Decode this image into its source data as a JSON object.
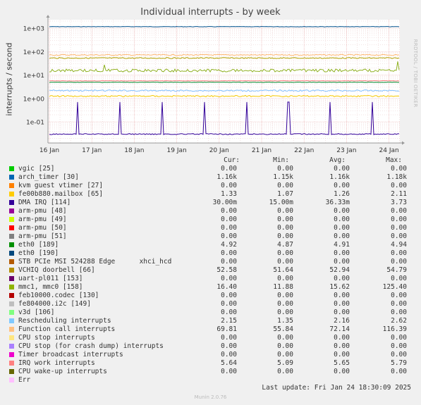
{
  "chart_data": {
    "type": "line",
    "title": "Individual interrupts - by week",
    "ylabel": "interrupts / second",
    "yscale": "log",
    "ylim": [
      0.02,
      1500
    ],
    "yticks": [
      "1e+03",
      "1e+02",
      "1e+01",
      "1e+00",
      "1e-01"
    ],
    "ytick_values": [
      1000,
      100,
      10,
      1,
      0.1
    ],
    "xticks": [
      "16 Jan",
      "17 Jan",
      "18 Jan",
      "19 Jan",
      "20 Jan",
      "21 Jan",
      "22 Jan",
      "23 Jan",
      "24 Jan"
    ],
    "grid": true,
    "series": [
      {
        "name": "arch_timer [30]",
        "color": "#00508c",
        "level": 1160
      },
      {
        "name": "Function call interrupts",
        "color": "#ffb870",
        "level": 72
      },
      {
        "name": "VCHIQ doorbell [66]",
        "color": "#b0a000",
        "level": 53
      },
      {
        "name": "mmc1, mmc0 [158]",
        "color": "#8fb021",
        "level": 15.6
      },
      {
        "name": "eth0 [189]",
        "color": "#008a2e",
        "level": 4.9
      },
      {
        "name": "IRQ work interrupts",
        "color": "#ff8080",
        "level": 5.65
      },
      {
        "name": "Rescheduling interrupts",
        "color": "#7fbfff",
        "level": 2.16
      },
      {
        "name": "fe00b880.mailbox [65]",
        "color": "#f5c800",
        "level": 1.26
      },
      {
        "name": "DMA IRQ [114]",
        "color": "#330099",
        "level": 0.03,
        "peak": 0.7
      }
    ]
  },
  "legend": {
    "headers": {
      "cur": "Cur:",
      "min": "Min:",
      "avg": "Avg:",
      "max": "Max:"
    },
    "rows": [
      {
        "label": "vgic [25]",
        "color": "#00cc00",
        "cur": "0.00",
        "min": "0.00",
        "avg": "0.00",
        "max": "0.00"
      },
      {
        "label": "arch_timer [30]",
        "color": "#0066b3",
        "cur": "1.16k",
        "min": "1.15k",
        "avg": "1.16k",
        "max": "1.18k"
      },
      {
        "label": "kvm guest vtimer [27]",
        "color": "#ff8000",
        "cur": "0.00",
        "min": "0.00",
        "avg": "0.00",
        "max": "0.00"
      },
      {
        "label": "fe00b880.mailbox [65]",
        "color": "#ffcc00",
        "cur": "1.33",
        "min": "1.07",
        "avg": "1.26",
        "max": "2.11"
      },
      {
        "label": "DMA IRQ [114]",
        "color": "#330099",
        "cur": "30.00m",
        "min": "15.00m",
        "avg": "36.33m",
        "max": "3.73"
      },
      {
        "label": "arm-pmu [48]",
        "color": "#990099",
        "cur": "0.00",
        "min": "0.00",
        "avg": "0.00",
        "max": "0.00"
      },
      {
        "label": "arm-pmu [49]",
        "color": "#ccff00",
        "cur": "0.00",
        "min": "0.00",
        "avg": "0.00",
        "max": "0.00"
      },
      {
        "label": "arm-pmu [50]",
        "color": "#ff0000",
        "cur": "0.00",
        "min": "0.00",
        "avg": "0.00",
        "max": "0.00"
      },
      {
        "label": "arm-pmu [51]",
        "color": "#808080",
        "cur": "0.00",
        "min": "0.00",
        "avg": "0.00",
        "max": "0.00"
      },
      {
        "label": "eth0 [189]",
        "color": "#008f00",
        "cur": "4.92",
        "min": "4.87",
        "avg": "4.91",
        "max": "4.94"
      },
      {
        "label": "eth0 [190]",
        "color": "#00487d",
        "cur": "0.00",
        "min": "0.00",
        "avg": "0.00",
        "max": "0.00"
      },
      {
        "label": "STB PCIe MSI 524288 Edge      xhci_hcd",
        "color": "#b35a00",
        "cur": "0.00",
        "min": "0.00",
        "avg": "0.00",
        "max": "0.00"
      },
      {
        "label": "VCHIQ doorbell [66]",
        "color": "#b38f00",
        "cur": "52.58",
        "min": "51.64",
        "avg": "52.94",
        "max": "54.79"
      },
      {
        "label": "uart-pl011 [153]",
        "color": "#6b006b",
        "cur": "0.00",
        "min": "0.00",
        "avg": "0.00",
        "max": "0.00"
      },
      {
        "label": "mmc1, mmc0 [158]",
        "color": "#8fb300",
        "cur": "16.40",
        "min": "11.88",
        "avg": "15.62",
        "max": "125.40"
      },
      {
        "label": "feb10000.codec [130]",
        "color": "#b30000",
        "cur": "0.00",
        "min": "0.00",
        "avg": "0.00",
        "max": "0.00"
      },
      {
        "label": "fe804000.i2c [149]",
        "color": "#bebebe",
        "cur": "0.00",
        "min": "0.00",
        "avg": "0.00",
        "max": "0.00"
      },
      {
        "label": "v3d [106]",
        "color": "#80ff80",
        "cur": "0.00",
        "min": "0.00",
        "avg": "0.00",
        "max": "0.00"
      },
      {
        "label": "Rescheduling interrupts",
        "color": "#80c9ff",
        "cur": "2.15",
        "min": "1.35",
        "avg": "2.16",
        "max": "2.62"
      },
      {
        "label": "Function call interrupts",
        "color": "#ffc080",
        "cur": "69.81",
        "min": "55.84",
        "avg": "72.14",
        "max": "116.39"
      },
      {
        "label": "CPU stop interrupts",
        "color": "#ffe680",
        "cur": "0.00",
        "min": "0.00",
        "avg": "0.00",
        "max": "0.00"
      },
      {
        "label": "CPU stop (for crash dump) interrupts",
        "color": "#aa80ff",
        "cur": "0.00",
        "min": "0.00",
        "avg": "0.00",
        "max": "0.00"
      },
      {
        "label": "Timer broadcast interrupts",
        "color": "#ee00cc",
        "cur": "0.00",
        "min": "0.00",
        "avg": "0.00",
        "max": "0.00"
      },
      {
        "label": "IRQ work interrupts",
        "color": "#ff8080",
        "cur": "5.64",
        "min": "5.09",
        "avg": "5.65",
        "max": "5.79"
      },
      {
        "label": "CPU wake-up interrupts",
        "color": "#666600",
        "cur": "0.00",
        "min": "0.00",
        "avg": "0.00",
        "max": "0.00"
      },
      {
        "label": "Err",
        "color": "#ffbfff",
        "cur": "",
        "min": "",
        "avg": "",
        "max": ""
      }
    ]
  },
  "side_text": "RRDTOOL / TOBI OETIKER",
  "last_update": "Last update:  Fri Jan 24 18:30:09 2025",
  "footer": "Munin 2.0.76"
}
